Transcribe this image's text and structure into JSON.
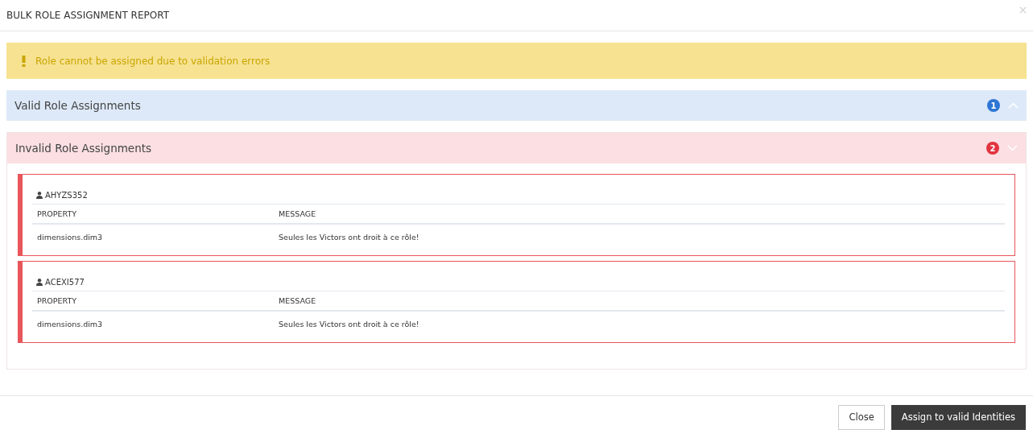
{
  "window": {
    "title": "BULK ROLE ASSIGNMENT REPORT"
  },
  "alert": {
    "kind": "warning",
    "message": "Role cannot be assigned due to validation errors"
  },
  "panels": [
    {
      "kind": "info",
      "title": "Valid Role Assignments",
      "count": "1",
      "expanded": false
    },
    {
      "kind": "danger",
      "title": "Invalid Role Assignments",
      "count": "2",
      "expanded": true,
      "items": [
        {
          "identity": "AHYZS352",
          "columns": [
            "PROPERTY",
            "MESSAGE"
          ],
          "rows": [
            [
              "dimensions.dim3",
              "Seules les Victors ont droit à ce rôle!"
            ]
          ]
        },
        {
          "identity": "ACEXI577",
          "columns": [
            "PROPERTY",
            "MESSAGE"
          ],
          "rows": [
            [
              "dimensions.dim3",
              "Seules les Victors ont droit à ce rôle!"
            ]
          ]
        }
      ]
    }
  ],
  "buttons": [
    {
      "label": "Close",
      "kind": "default"
    },
    {
      "label": "Assign to valid Identities",
      "kind": "primary"
    }
  ]
}
